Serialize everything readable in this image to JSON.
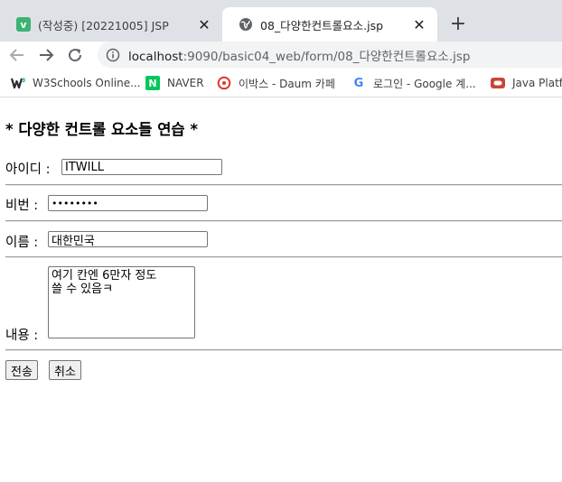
{
  "browser": {
    "tabs": [
      {
        "title": "(작성중) [20221005] JSP",
        "favicon": "velog-v-icon",
        "favicon_glyph": "v",
        "active": false
      },
      {
        "title": "08_다양한컨트롤요소.jsp",
        "favicon": "globe-icon",
        "active": true
      }
    ],
    "close_glyph": "✕",
    "newtab_glyph": "+",
    "url_host": "localhost",
    "url_path": ":9090/basic04_web/form/08_다양한컨트롤요소.jsp"
  },
  "bookmarks": [
    {
      "label": "W3Schools Online...",
      "icon": "w3schools-icon"
    },
    {
      "label": "NAVER",
      "icon": "naver-icon",
      "glyph": "N"
    },
    {
      "label": "이박스 - Daum 카페",
      "icon": "daum-cafe-icon"
    },
    {
      "label": "로그인 - Google 계...",
      "icon": "google-icon",
      "glyph": "G"
    },
    {
      "label": "Java Platfo",
      "icon": "oracle-icon"
    }
  ],
  "page": {
    "title": "* 다양한 컨트롤 요소들 연습 *",
    "id_label": "아이디 : ",
    "id_value": "ITWILL",
    "pw_label": "비번 : ",
    "pw_value": "••••••••",
    "name_label": "이름 : ",
    "name_value": "대한민국",
    "content_label": "내용 : ",
    "content_value": "여기 칸엔 6만자 정도\n쓸 수 있음ㅋ",
    "submit_label": "전송",
    "cancel_label": "취소"
  },
  "colors": {
    "tabstrip_bg": "#dee1e6",
    "omnibox_bg": "#f1f3f4",
    "naver_green": "#03c75a",
    "velog_green": "#3cb371",
    "daum_red": "#e0352b",
    "oracle_red": "#c74634"
  }
}
